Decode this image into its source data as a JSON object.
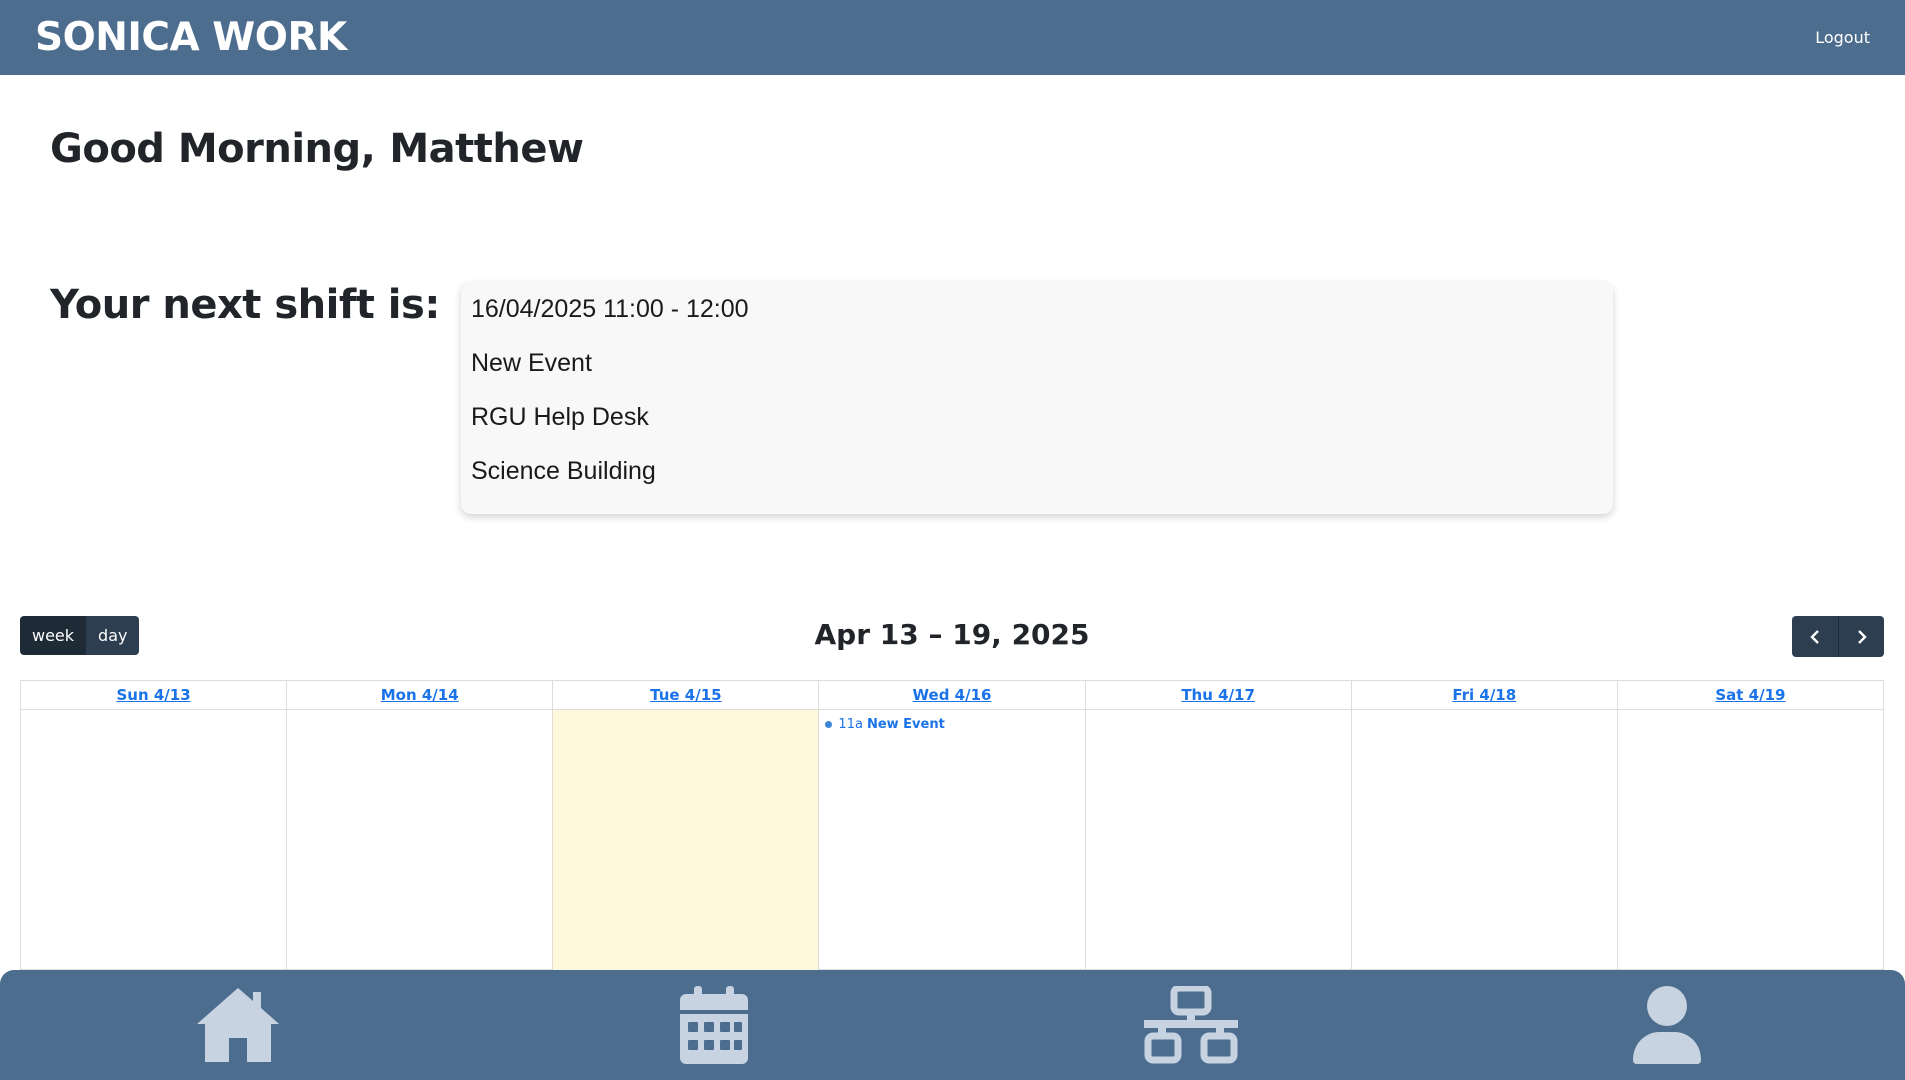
{
  "app": {
    "brand": "SONICA WORK",
    "logout_label": "Logout"
  },
  "greeting": {
    "text": "Good Morning,",
    "name": "Matthew"
  },
  "next_shift": {
    "label": "Your next shift is:",
    "datetime": "16/04/2025 11:00 - 12:00",
    "event": "New Event",
    "role": "RGU Help Desk",
    "location": "Science Building"
  },
  "calendar": {
    "view_week": "week",
    "view_day": "day",
    "title": "Apr 13 – 19, 2025",
    "days": [
      {
        "label": "Sun 4/13"
      },
      {
        "label": "Mon 4/14"
      },
      {
        "label": "Tue 4/15"
      },
      {
        "label": "Wed 4/16"
      },
      {
        "label": "Thu 4/17"
      },
      {
        "label": "Fri 4/18"
      },
      {
        "label": "Sat 4/19"
      }
    ],
    "events": [
      {
        "time": "11a",
        "title": "New Event"
      }
    ]
  },
  "nav": [
    "home-icon",
    "calendar-icon",
    "network-icon",
    "user-icon"
  ],
  "colors": {
    "bar": "#4d6d8f",
    "button": "#2c3e50",
    "today": "#fef8dd",
    "link": "#1a73e8"
  }
}
